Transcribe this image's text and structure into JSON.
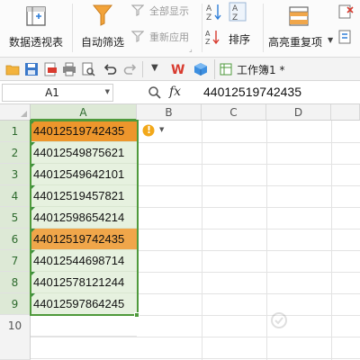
{
  "ribbon": {
    "pivot_label": "数据透视表",
    "autofilter_label": "自动筛选",
    "show_all_label": "全部显示",
    "reapply_label": "重新应用",
    "sort_label": "排序",
    "highlight_dup_label": "高亮重复项"
  },
  "qat": {
    "doc_tab_label": "工作簿1 *"
  },
  "formula_bar": {
    "name_box": "A1",
    "fx_label": "fx",
    "formula_value": "44012519742435"
  },
  "sheet": {
    "columns": [
      "A",
      "B",
      "C",
      "D"
    ],
    "rows": [
      {
        "num": "1",
        "a": "44012519742435"
      },
      {
        "num": "2",
        "a": "44012549875621"
      },
      {
        "num": "3",
        "a": "44012549642101"
      },
      {
        "num": "4",
        "a": "44012519457821"
      },
      {
        "num": "5",
        "a": "44012598654214"
      },
      {
        "num": "6",
        "a": "44012519742435"
      },
      {
        "num": "7",
        "a": "44012544698714"
      },
      {
        "num": "8",
        "a": "44012578121244"
      },
      {
        "num": "9",
        "a": "44012597864245"
      },
      {
        "num": "10",
        "a": ""
      }
    ],
    "warning_glyph": "!",
    "duplicate_color": "#f0a64a",
    "active_color": "#ed962c",
    "selection_border_color": "#4f9a3c"
  }
}
